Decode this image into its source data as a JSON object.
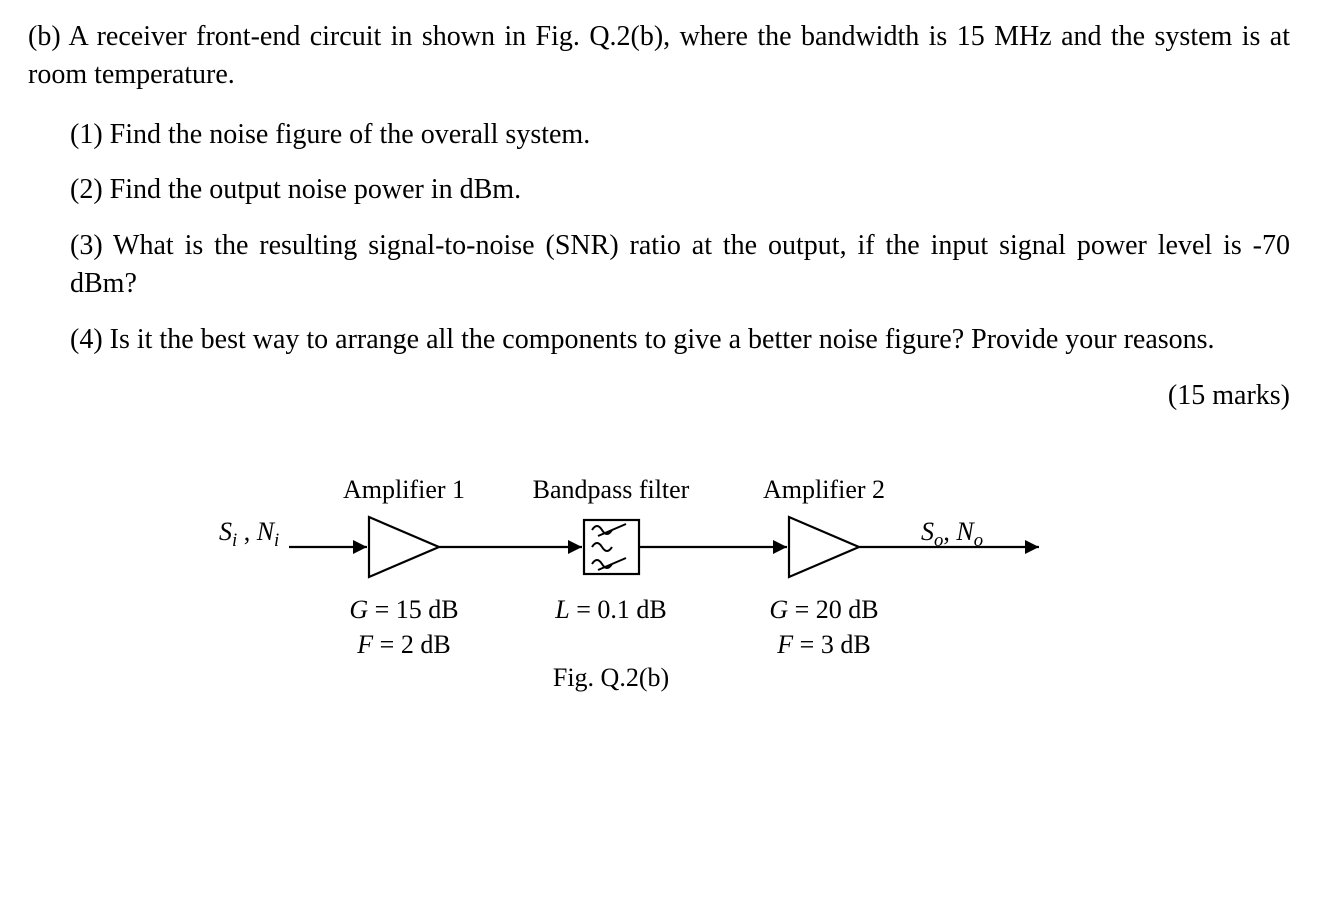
{
  "intro": "(b) A receiver front-end circuit in shown in Fig. Q.2(b), where the bandwidth is 15 MHz and the system is at room temperature.",
  "items": [
    "(1) Find the noise figure of the overall system.",
    "(2) Find the output noise power in dBm.",
    "(3) What is the resulting signal-to-noise (SNR) ratio at the output, if the input signal power level is -70 dBm?",
    "(4) Is it the best way to arrange all the components to give a better noise figure? Provide your reasons."
  ],
  "marks": "(15 marks)",
  "diagram": {
    "labels": {
      "amp1": "Amplifier 1",
      "bpf": "Bandpass filter",
      "amp2": "Amplifier 2",
      "in_sig": "S",
      "in_sub1": "i",
      "in_sep": " , ",
      "in_noise": "N",
      "in_sub2": "i",
      "out_sig": "S",
      "out_sub1": "o",
      "out_sep": ", ",
      "out_noise": "N",
      "out_sub2": "o"
    },
    "specs": {
      "amp1_g": "G = 15 dB",
      "amp1_f": "F = 2 dB",
      "bpf_l": "L = 0.1 dB",
      "amp2_g": "G = 20 dB",
      "amp2_f": "F = 3 dB"
    },
    "caption": "Fig. Q.2(b)"
  }
}
